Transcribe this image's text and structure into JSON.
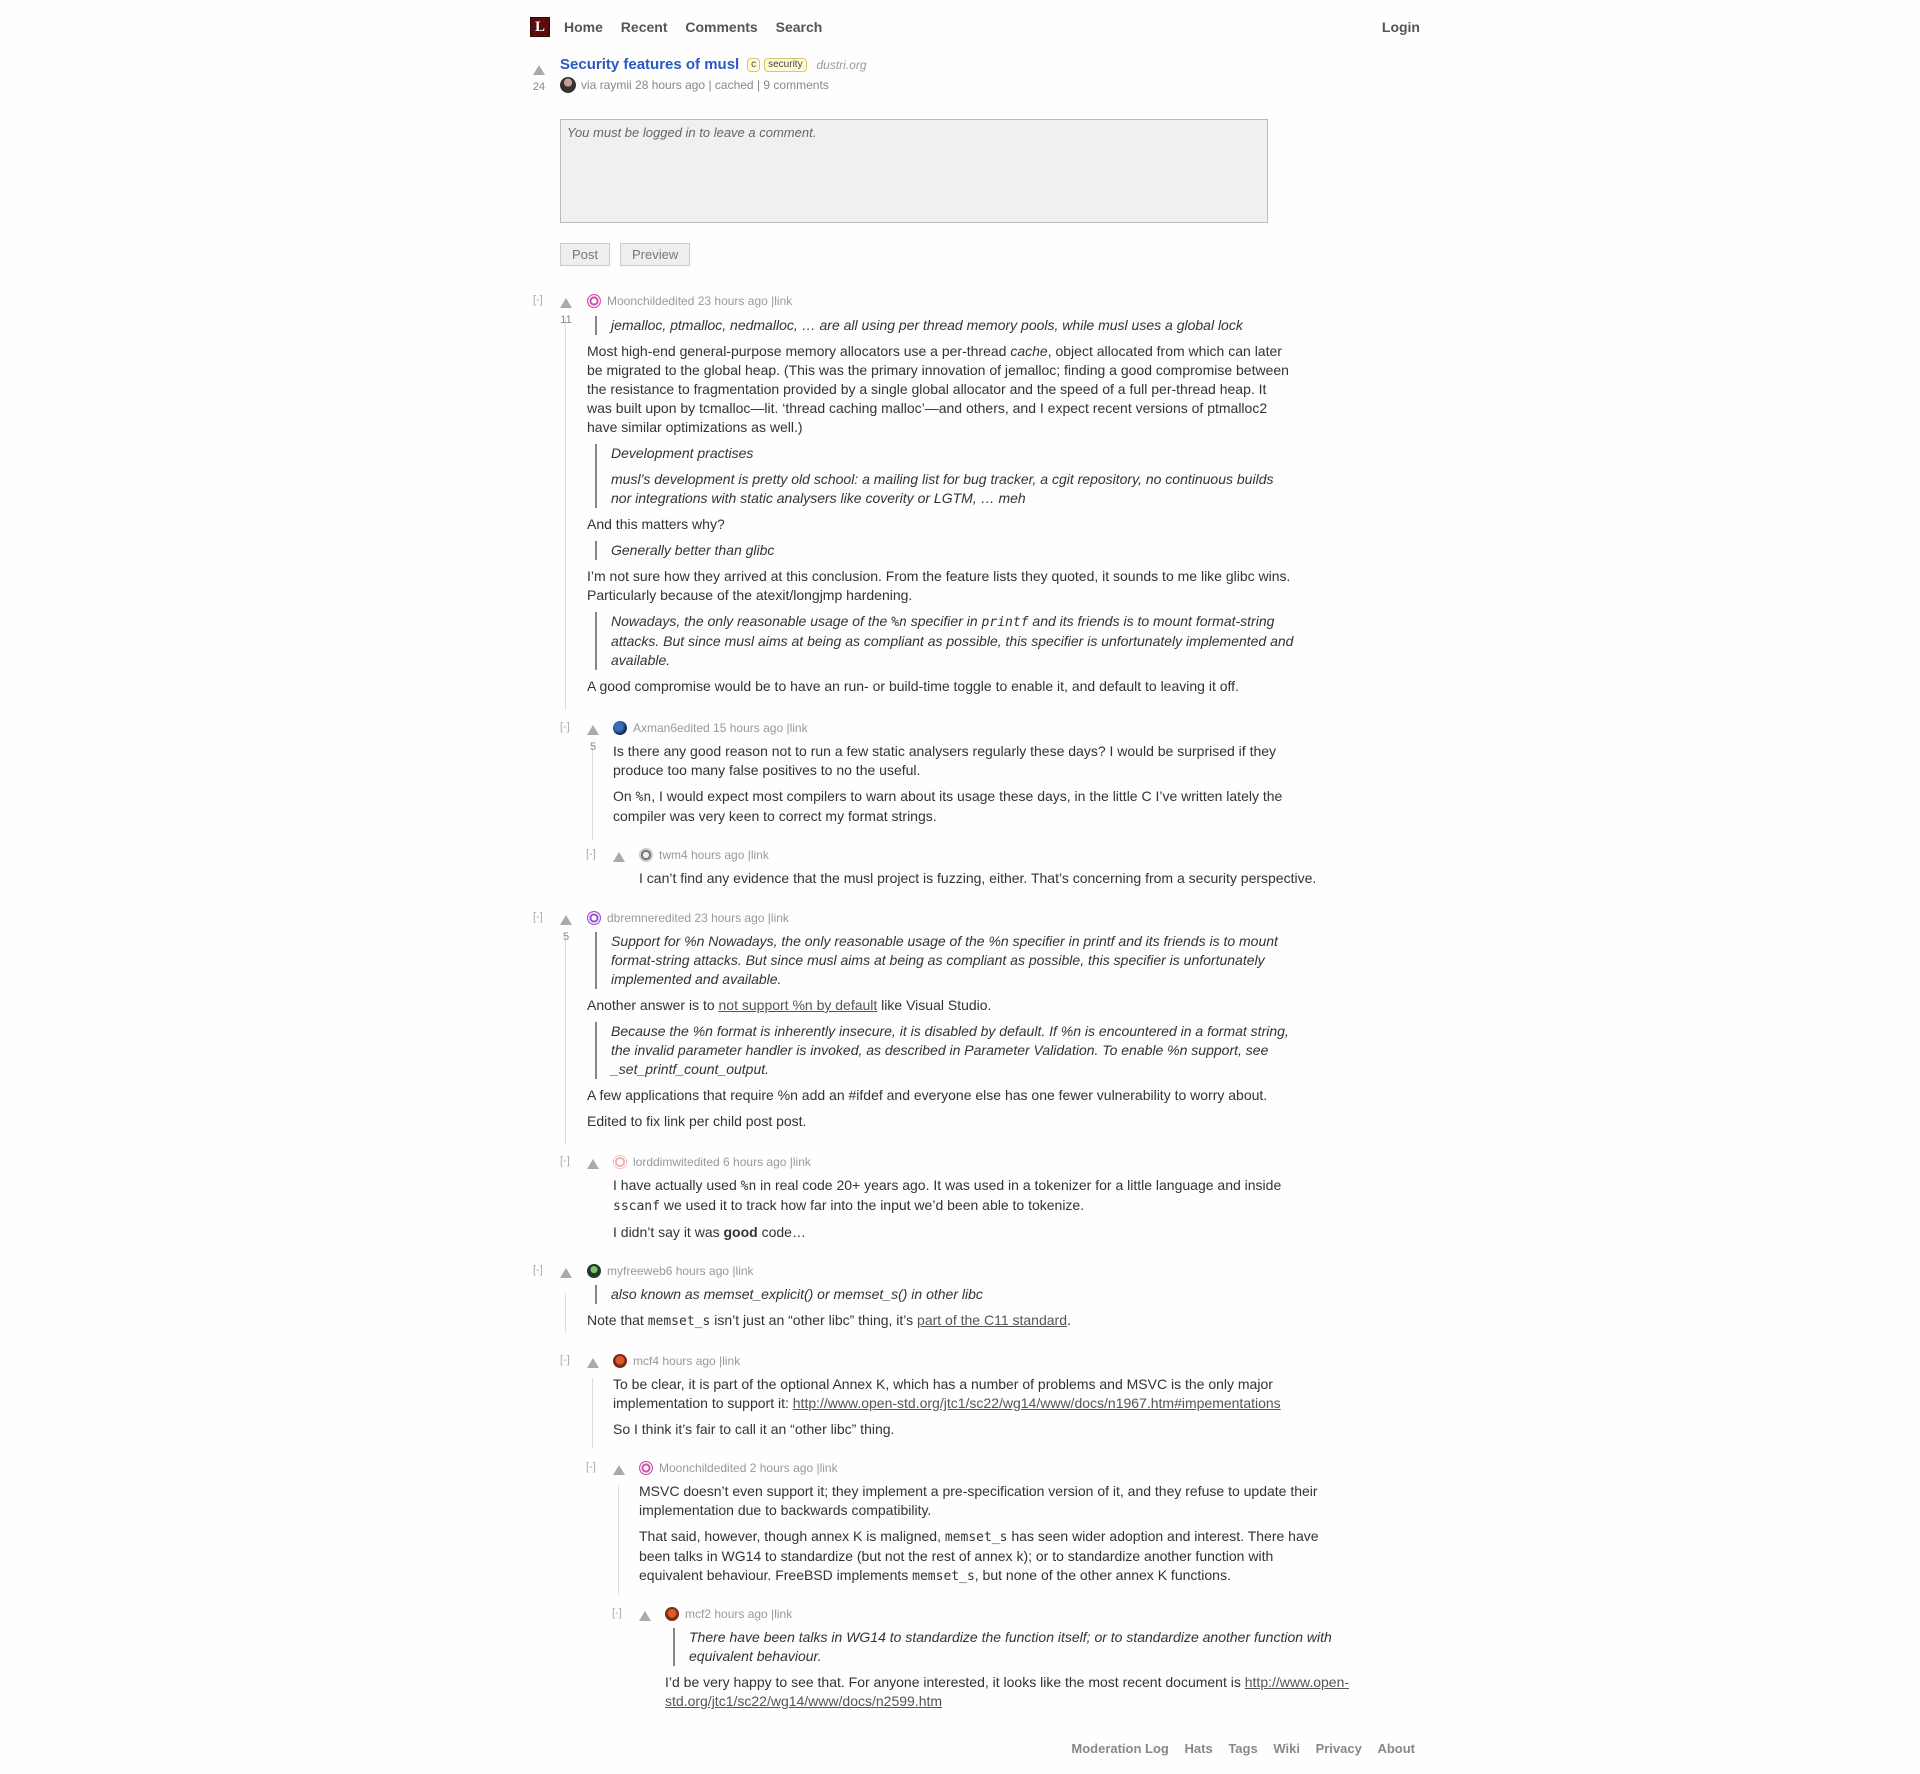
{
  "nav": {
    "logo": "L",
    "items": [
      "Home",
      "Recent",
      "Comments",
      "Search"
    ],
    "login": "Login"
  },
  "story": {
    "title": "Security features of musl",
    "tags": [
      "c",
      "security"
    ],
    "domain": "dustri.org",
    "score": "24",
    "via": "via",
    "user": "raymii",
    "time": "28 hours ago",
    "cached": "cached",
    "comments": "9 comments",
    "sep": "|"
  },
  "comment_form": {
    "placeholder": "You must be logged in to leave a comment.",
    "post": "Post",
    "preview": "Preview"
  },
  "toggle": "[-]",
  "link_label": "link",
  "comments": [
    {
      "user": "Moonchild",
      "meta": " edited 23 hours ago | ",
      "score": "11",
      "q1": "jemalloc, ptmalloc, nedmalloc, … are all using per thread memory pools, while musl uses a global lock",
      "p1a": "Most high-end general-purpose memory allocators use a per-thread ",
      "p1em": "cache",
      "p1b": ", object allocated from which can later be migrated to the global heap. (This was the primary innovation of jemalloc; finding a good compromise between the resistance to fragmentation provided by a single global allocator and the speed of a full per-thread heap. It was built upon by tcmalloc—lit. ‘thread caching malloc’—and others, and I expect recent versions of ptmalloc2 have similar optimizations as well.)",
      "q2a": "Development practises",
      "q2b": "musl’s development is pretty old school: a mailing list for bug tracker, a cgit repository, no continuous builds nor integrations with static analysers like coverity or LGTM, … meh",
      "p2": "And this matters why?",
      "q3": "Generally better than glibc",
      "p3": "I’m not sure how they arrived at this conclusion. From the feature lists they quoted, it sounds to me like glibc wins. Particularly because of the atexit/longjmp hardening.",
      "q4a": "Nowadays, the only reasonable usage of the ",
      "q4code": "%n",
      "q4b": " specifier in ",
      "q4code2": "printf",
      "q4c": " and its friends is to mount format-string attacks. But since musl aims at being as compliant as possible, this specifier is unfortunately implemented and available.",
      "p4": "A good compromise would be to have an run- or build-time toggle to enable it, and default to leaving it off."
    },
    {
      "user": "Axman6",
      "meta": " edited 15 hours ago | ",
      "score": "5",
      "p1": "Is there any good reason not to run a few static analysers regularly these days? I would be surprised if they produce too many false positives to no the useful.",
      "p2a": "On ",
      "p2code": "%n",
      "p2b": ", I would expect most compilers to warn about its usage these days, in the little C I’ve written lately the compiler was very keen to correct my format strings."
    },
    {
      "user": "twm",
      "meta": " 4 hours ago | ",
      "p1": "I can’t find any evidence that the musl project is fuzzing, either. That’s concerning from a security perspective."
    },
    {
      "user": "dbremner",
      "meta": " edited 23 hours ago | ",
      "score": "5",
      "q1": "Support for %n Nowadays, the only reasonable usage of the %n specifier in printf and its friends is to mount format-string attacks. But since musl aims at being as compliant as possible, this specifier is unfortunately implemented and available.",
      "p1a": "Another answer is to ",
      "p1link": "not support %n by default",
      "p1b": " like Visual Studio.",
      "q2": "Because the %n format is inherently insecure, it is disabled by default. If %n is encountered in a format string, the invalid parameter handler is invoked, as described in Parameter Validation. To enable %n support, see _set_printf_count_output.",
      "p2": "A few applications that require %n add an #ifdef and everyone else has one fewer vulnerability to worry about.",
      "p3": "Edited to fix link per child post post."
    },
    {
      "user": "lorddimwit",
      "meta": " edited 6 hours ago | ",
      "p1a": "I have actually used ",
      "p1code": "%n",
      "p1b": " in real code 20+ years ago. It was used in a tokenizer for a little language and inside ",
      "p1code2": "sscanf",
      "p1c": " we used it to track how far into the input we’d been able to tokenize.",
      "p2a": "I didn’t say it was ",
      "p2b": "good",
      "p2c": " code…"
    },
    {
      "user": "myfreeweb",
      "meta": " 6 hours ago | ",
      "q1": "also known as memset_explicit() or memset_s() in other libc",
      "p1a": "Note that ",
      "p1code": "memset_s",
      "p1b": " isn’t just an “other libc” thing, it’s ",
      "p1link": "part of the C11 standard",
      "p1c": "."
    },
    {
      "user": "mcf",
      "meta": " 4 hours ago | ",
      "p1a": "To be clear, it is part of the optional Annex K, which has a number of problems and MSVC is the only major implementation to support it: ",
      "p1link": "http://www.open-std.org/jtc1/sc22/wg14/www/docs/n1967.htm#impementations",
      "p2": "So I think it’s fair to call it an “other libc” thing."
    },
    {
      "user": "Moonchild",
      "meta": " edited 2 hours ago | ",
      "p1": "MSVC doesn’t even support it; they implement a pre-specification version of it, and they refuse to update their implementation due to backwards compatibility.",
      "p2a": "That said, however, though annex K is maligned, ",
      "p2code": "memset_s",
      "p2b": " has seen wider adoption and interest. There have been talks in WG14 to standardize (but not the rest of annex k); or to standardize another function with equivalent behaviour. FreeBSD implements ",
      "p2code2": "memset_s",
      "p2c": ", but none of the other annex K functions."
    },
    {
      "user": "mcf",
      "meta": " 2 hours ago | ",
      "q1": "There have been talks in WG14 to standardize the function itself; or to standardize another function with equivalent behaviour.",
      "p1a": "I’d be very happy to see that. For anyone interested, it looks like the most recent document is ",
      "p1link": "http://www.open-std.org/jtc1/sc22/wg14/www/docs/n2599.htm"
    }
  ],
  "footer": [
    "Moderation Log",
    "Hats",
    "Tags",
    "Wiki",
    "Privacy",
    "About"
  ],
  "colors": {
    "title_link": "#2a58c6",
    "logo_bg": "#5a0b0b",
    "tag_bg": "#fffcd7"
  }
}
